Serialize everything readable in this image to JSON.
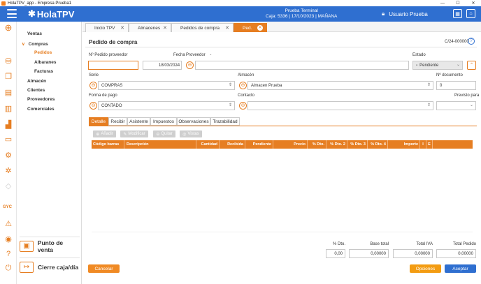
{
  "window": {
    "title": "HolaTPV_app - Empresa Prueba1",
    "controls": [
      "—",
      "☐",
      "✕"
    ]
  },
  "header": {
    "logo": "HolaTPV",
    "terminal_name": "Prueba Terminal",
    "terminal_info": "Caja: 5336 | 17/10/2023 | MAÑANA",
    "user": "Usuario Prueba"
  },
  "rail": {
    "brand_text": "GYC"
  },
  "nav": {
    "items": [
      {
        "label": "Ventas"
      },
      {
        "label": "Compras",
        "prefix": "∨"
      },
      {
        "label": "Pedidos"
      },
      {
        "label": "Albaranes"
      },
      {
        "label": "Facturas"
      },
      {
        "label": "Almacén"
      },
      {
        "label": "Clientes"
      },
      {
        "label": "Proveedores"
      },
      {
        "label": "Comerciales"
      }
    ],
    "bottom": [
      {
        "label": "Punto de venta"
      },
      {
        "label": "Cierre caja/día"
      }
    ]
  },
  "tabs": [
    {
      "label": "Inicio TPV"
    },
    {
      "label": "Almacenes"
    },
    {
      "label": "Pedidos de compra"
    },
    {
      "label": "Ped."
    }
  ],
  "form": {
    "title": "Pedido de compra",
    "doc_code": "C/24-000000",
    "labels": {
      "pedido_proveedor": "Nº Pedido proveedor",
      "fecha": "Fecha",
      "proveedor": "Proveedor",
      "proveedor_dash": "-",
      "estado": "Estado",
      "serie": "Serie",
      "almacen": "Almacén",
      "num_documento": "Nº documento",
      "forma_pago": "Forma de pago",
      "contacto": "Contacto",
      "previsto_para": "Previsto para"
    },
    "values": {
      "pedido_proveedor": "",
      "fecha": "18/03/2024",
      "proveedor": "",
      "estado": "Pendiente",
      "serie": "COMPRAS",
      "almacen": "Almacen Prueba",
      "num_documento": "0",
      "forma_pago": "CONTADO",
      "contacto": "",
      "previsto_para": ""
    }
  },
  "detail_tabs": [
    {
      "label": "Detalle"
    },
    {
      "label": "Recibir"
    },
    {
      "label": "Asistente"
    },
    {
      "label": "Impuestos"
    },
    {
      "label": "Observaciones"
    },
    {
      "label": "Trazabilidad"
    }
  ],
  "toolbar": {
    "add": "Añadir",
    "modify": "Modificar",
    "remove": "Quitar",
    "views": "Vistas"
  },
  "grid": {
    "columns": [
      "Código barras",
      "Descripción",
      "Cantidad",
      "Recibida",
      "Pendiente",
      "Precio",
      "% Dto.",
      "% Dto. 2",
      "% Dto. 3",
      "% Dto. 4",
      "Importe",
      "I",
      "E"
    ]
  },
  "totals": [
    {
      "label": "% Dto.",
      "value": "0,00"
    },
    {
      "label": "Base total",
      "value": "0,00000"
    },
    {
      "label": "Total IVA",
      "value": "0,00000"
    },
    {
      "label": "Total Pedido",
      "value": "0,00000"
    }
  ],
  "footer": {
    "cancel": "Cancelar",
    "options": "Opciones",
    "accept": "Aceptar"
  },
  "colors": {
    "primary": "#2f6fd0",
    "accent": "#e67e22"
  }
}
